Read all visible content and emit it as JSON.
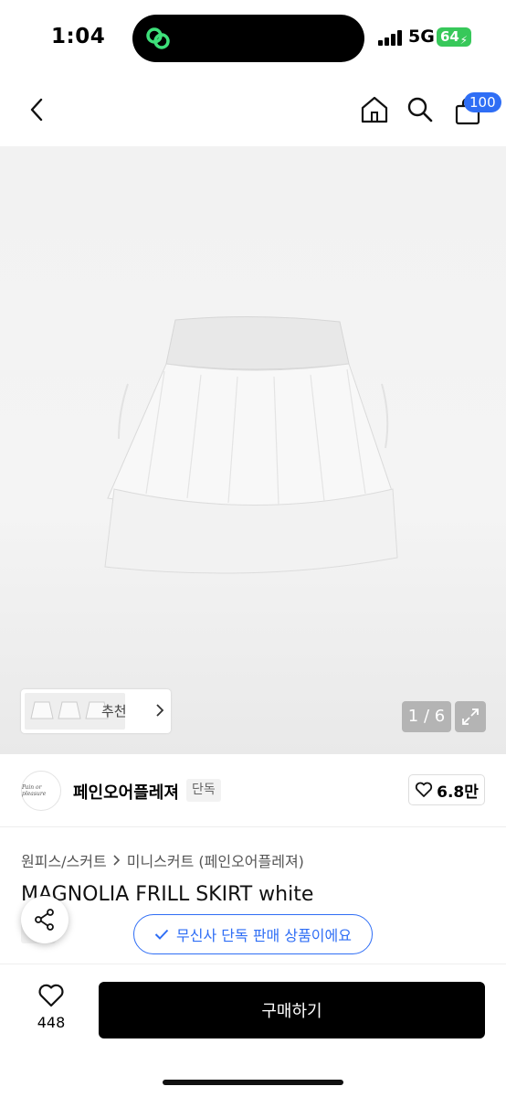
{
  "status": {
    "time": "1:04",
    "network": "5G",
    "battery": "64"
  },
  "nav": {
    "cart_count": "100"
  },
  "gallery": {
    "reco_label": "추천",
    "counter": "1 / 6"
  },
  "brand": {
    "name": "페인오어플레져",
    "logo_text": "Pain or pleasure",
    "tag": "단독",
    "likes": "6.8만"
  },
  "breadcrumb": {
    "category": "원피스/스커트",
    "subcategory": "미니스커트 (페인오어플레져)"
  },
  "product": {
    "title": "MAGNOLIA FRILL SKIRT white",
    "tag": "단독",
    "exclusive_notice": "무신사 단독 판매 상품이에요"
  },
  "bottom": {
    "wish_count": "448",
    "buy_label": "구매하기"
  },
  "colors": {
    "accent": "#2f6ef5",
    "battery": "#37c85a",
    "buy_button": "#000000"
  }
}
